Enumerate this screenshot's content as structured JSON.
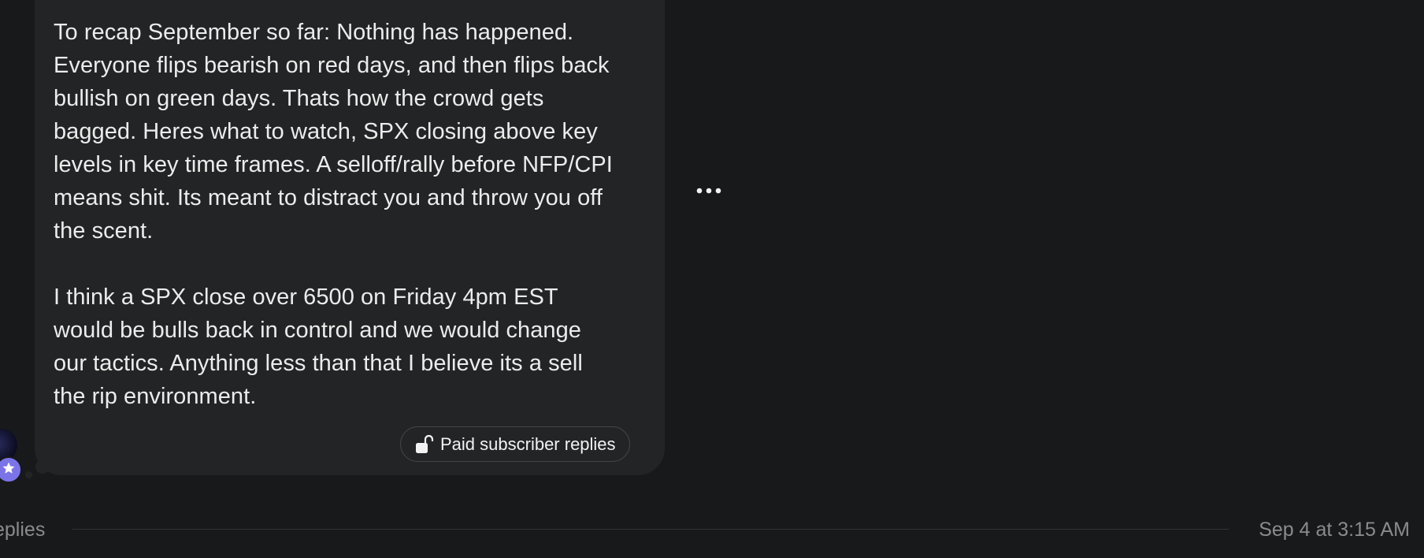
{
  "message": {
    "paragraphs": [
      "To recap September so far: Nothing has happened.\nEveryone flips bearish on red days, and then flips back\nbullish on green days. Thats how the crowd gets\nbagged. Heres what to watch, SPX closing above key\nlevels in key time frames. A selloff/rally before NFP/CPI\nmeans shit. Its meant to distract you and throw you off\nthe scent.",
      "I think a SPX close over 6500 on Friday 4pm EST\nwould be bulls back in control and we would change\nour tactics. Anything less than that I believe its a sell\nthe rip environment."
    ],
    "replies_button_label": "Paid subscriber replies",
    "lock_icon": "unlock-icon",
    "more_icon": "more-horizontal-icon"
  },
  "author": {
    "avatar_icon": "avatar",
    "badge_icon": "star-icon",
    "badge_color": "#7b74e8"
  },
  "footer": {
    "replies_label": "eplies",
    "timestamp": "Sep 4 at 3:15 AM"
  },
  "colors": {
    "background": "#18191b",
    "bubble": "#232425",
    "text": "#ececec",
    "muted": "#8a8b8d"
  }
}
